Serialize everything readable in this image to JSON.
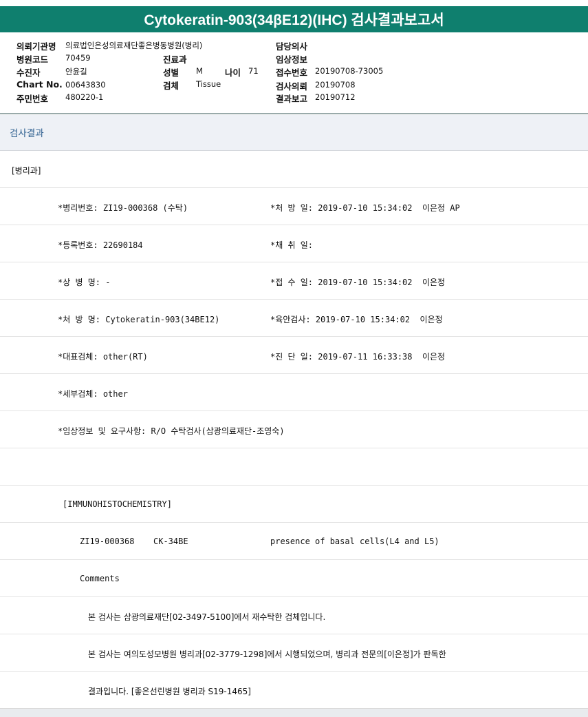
{
  "title": "Cytokeratin-903(34βE12)(IHC) 검사결과보고서",
  "info": {
    "institution_label": "의뢰기관명",
    "institution": "의료법인은성의료재단좋은병동병원(병리)",
    "doctor_label": "담당의사",
    "doctor": "",
    "hospital_code_label": "병원코드",
    "hospital_code": "70459",
    "department_label": "진료과",
    "department": "",
    "clinical_info_label": "임상정보",
    "clinical_info": "",
    "patient_label": "수진자",
    "patient": "안윤길",
    "sex_label": "성별",
    "sex": "M",
    "age_label": "나이",
    "age": "71",
    "receipt_no_label": "접수번호",
    "receipt_no": "20190708-73005",
    "chart_label": "Chart No.",
    "chart_no": "00643830",
    "specimen_label": "검체",
    "specimen": "Tissue",
    "request_label": "검사의뢰",
    "request_date": "20190708",
    "id_label": "주민번호",
    "id_no": "480220-1",
    "report_label": "결과보고",
    "report_date": "20190712"
  },
  "section_title": "검사결과",
  "rows": [
    [
      "[병리과]",
      ""
    ],
    [
      "*병리번호: ZI19-000368 (수탁)",
      "*처 방 일: 2019-07-10 15:34:02  이은정 AP"
    ],
    [
      "*등록번호: 22690184",
      "*채 취 일:"
    ],
    [
      "*상 병 명: -",
      "*접 수 일: 2019-07-10 15:34:02  이은정"
    ],
    [
      "*처 방 명: Cytokeratin-903(34BE12)",
      "*육안검사: 2019-07-10 15:34:02  이은정"
    ],
    [
      "*대표검체: other(RT)",
      "*진 단 일: 2019-07-11 16:33:38  이은정"
    ],
    [
      "*세부검체: other",
      ""
    ],
    [
      "*임상정보 및 요구사항: R/O 수탁검사(삼광의료재단-조영숙)",
      ""
    ],
    [
      "",
      ""
    ],
    [
      "[IMMUNOHISTOCHEMISTRY]",
      ""
    ],
    [
      "ZI19-000368",
      "CK-34BE",
      "presence of basal cells(L4 and L5)"
    ],
    [
      "Comments",
      ""
    ],
    [
      "본 검사는 삼광의료재단[02-3497-5100]에서 재수탁한 검체입니다.",
      ""
    ],
    [
      "본 검사는 여의도성모병원 병리과[02-3779-1298]에서 시행되었으며, 병리과 전문의[이은정]가 판독한",
      ""
    ],
    [
      "결과입니다. [좋은선린병원 병리과 S19-1465]",
      ""
    ]
  ]
}
